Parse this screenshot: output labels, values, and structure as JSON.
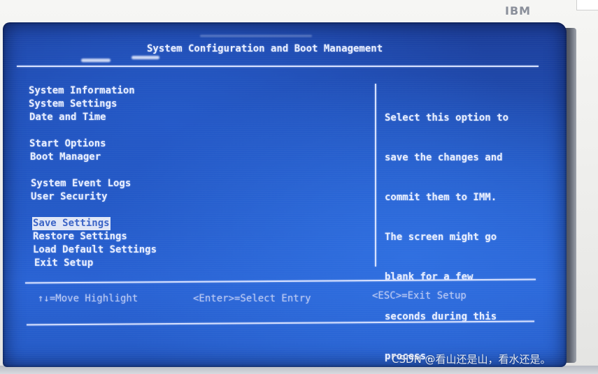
{
  "bezel": {
    "logo": "IBM"
  },
  "screen": {
    "title": "System Configuration and Boot Management",
    "menu": [
      {
        "label": "System Information",
        "selected": false
      },
      {
        "label": "System Settings",
        "selected": false
      },
      {
        "label": "Date and Time",
        "selected": false
      },
      {
        "label": "Start Options",
        "selected": false
      },
      {
        "label": "Boot Manager",
        "selected": false
      },
      {
        "label": "System Event Logs",
        "selected": false
      },
      {
        "label": "User Security",
        "selected": false
      },
      {
        "label": "Save Settings",
        "selected": true
      },
      {
        "label": "Restore Settings",
        "selected": false
      },
      {
        "label": "Load Default Settings",
        "selected": false
      },
      {
        "label": "Exit Setup",
        "selected": false
      }
    ],
    "help": {
      "lines": [
        "Select this option to",
        "save the changes and",
        "commit them to IMM.",
        "The screen might go",
        "blank for a few",
        "seconds during this",
        "process."
      ]
    },
    "footer": {
      "move": "↑↓=Move Highlight",
      "enter": "<Enter>=Select Entry",
      "esc": "<ESC>=Exit Setup"
    }
  },
  "watermark": "CSDN @看山还是山，看水还是。",
  "colors": {
    "screen_blue": "#2256c0",
    "text": "#e8eeff",
    "highlight_bg": "#dfe6f7",
    "highlight_text": "#3a63c6"
  }
}
